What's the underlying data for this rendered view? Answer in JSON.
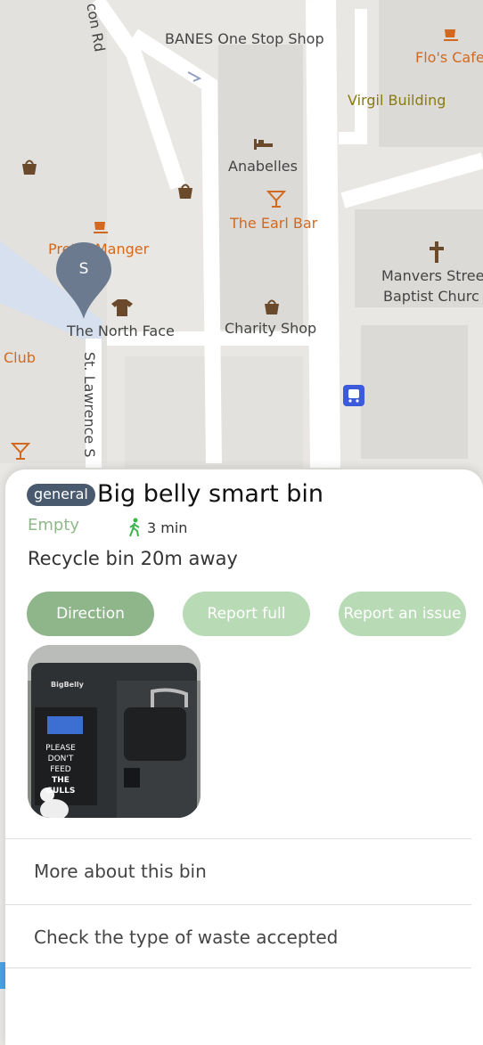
{
  "map": {
    "labels": {
      "street_con_rd": "con Rd",
      "banes": "BANES One Stop Shop",
      "flos_cafe": "Flo's Cafe",
      "virgil": "Virgil Building",
      "anabelles": "Anabelles",
      "earl_bar": "The Earl Bar",
      "pret": "Pret A Manger",
      "manvers_1": "Manvers Stree",
      "manvers_2": "Baptist Churc",
      "north_face": "The North Face",
      "charity": "Charity Shop",
      "club": "Club",
      "st_lawrence": "St. Lawrence S"
    },
    "marker_letter": "S",
    "colors": {
      "marker": "#6b7a8f",
      "poi_orange": "#d2691e",
      "bus": "#3b5bdb"
    }
  },
  "card": {
    "badge": "general",
    "title": "Big belly smart bin",
    "status": "Empty",
    "walk_time": "3 min",
    "recycle_info": "Recycle bin 20m away",
    "buttons": {
      "direction": "Direction",
      "report_full": "Report full",
      "report_issue": "Report an issue"
    },
    "photo": {
      "brand": "BigBelly",
      "sign_line1": "PLEASE",
      "sign_line2": "DON'T FEED",
      "sign_line3": "THE GULLS"
    },
    "links": {
      "more_about": "More about this bin",
      "check_waste": "Check the type of waste accepted"
    }
  }
}
